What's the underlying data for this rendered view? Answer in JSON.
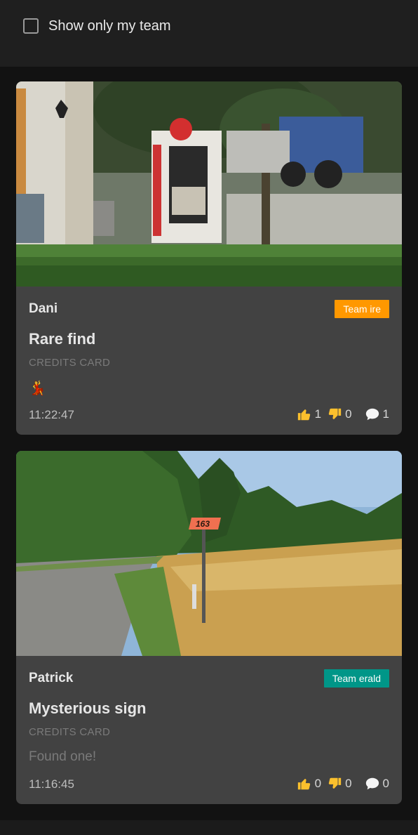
{
  "filter": {
    "label": "Show only my team",
    "checked": false
  },
  "cards": [
    {
      "author": "Dani",
      "team": "Team ire",
      "team_color": "#ff9800",
      "title": "Rare find",
      "subtitle": "CREDITS CARD",
      "body": "💃",
      "time": "11:22:47",
      "likes": "1",
      "dislikes": "0",
      "comments": "1",
      "image": "street scene with vending kiosk, tree, hedge and truck"
    },
    {
      "author": "Patrick",
      "team": "Team erald",
      "team_color": "#009688",
      "title": "Mysterious sign",
      "subtitle": "CREDITS CARD",
      "body": "Found one!",
      "time": "11:16:45",
      "likes": "0",
      "dislikes": "0",
      "comments": "0",
      "image": "country road beside wheat field with number sign 163"
    }
  ],
  "photo_text": {
    "sign_number": "163"
  },
  "icons": {
    "like": "thumbs-up-icon",
    "dislike": "thumbs-down-icon",
    "comment": "speech-bubble-icon"
  }
}
